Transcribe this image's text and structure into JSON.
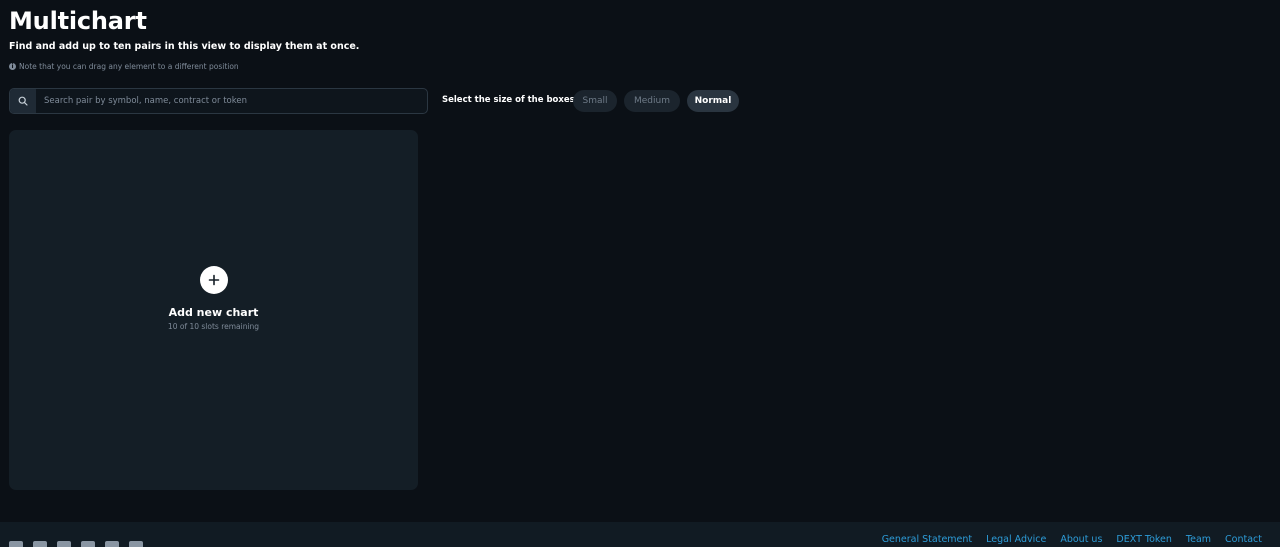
{
  "header": {
    "title": "Multichart",
    "subtitle": "Find and add up to ten pairs in this view to display them at once.",
    "note": "Note that you can drag any element to a different position"
  },
  "search": {
    "placeholder": "Search pair by symbol, name, contract or token",
    "value": ""
  },
  "size_selector": {
    "label": "Select the size of the boxes:",
    "options": [
      "Small",
      "Medium",
      "Normal"
    ],
    "selected": "Normal"
  },
  "chart_slot": {
    "add_label": "Add new chart",
    "remaining": "10 of 10 slots remaining"
  },
  "footer": {
    "social_icons": [
      "x-icon",
      "reddit-icon",
      "discord-icon",
      "instagram-icon",
      "tiktok-icon",
      "youtube-icon"
    ],
    "links": [
      "General Statement",
      "Legal Advice",
      "About us",
      "DEXT Token",
      "Team",
      "Contact"
    ]
  },
  "colors": {
    "background": "#0b1016",
    "panel": "#141e26",
    "link": "#2d9cd8",
    "muted": "#7f8b99"
  }
}
